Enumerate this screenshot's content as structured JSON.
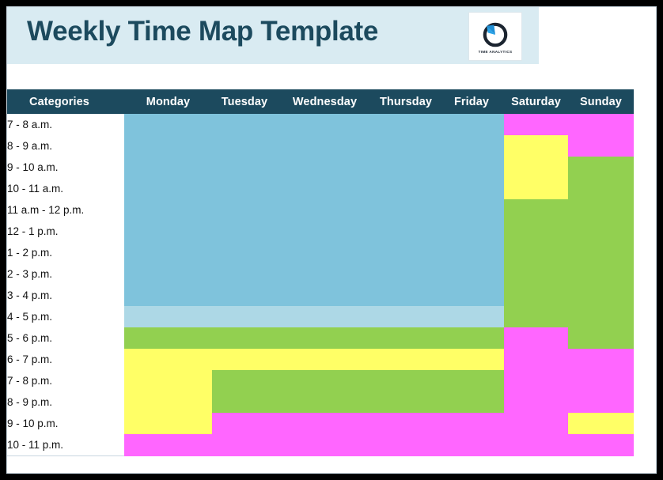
{
  "document": {
    "title": "Weekly Time Map Template"
  },
  "logo": {
    "icon": "clock-circle-arrow-icon",
    "label": "TIME ANALYTICS"
  },
  "colors": {
    "header_bar": "#1c4a5e",
    "banner_bg": "#d9ebf2",
    "title_text": "#1c4a5e",
    "blue": "#7fc3dc",
    "light_blue": "#add8e6",
    "green": "#92d050",
    "yellow": "#ffff66",
    "magenta": "#ff66ff",
    "page_border": "#000000"
  },
  "table": {
    "columns": [
      {
        "key": "categories",
        "label": "Categories"
      },
      {
        "key": "monday",
        "label": "Monday"
      },
      {
        "key": "tuesday",
        "label": "Tuesday"
      },
      {
        "key": "wednesday",
        "label": "Wednesday"
      },
      {
        "key": "thursday",
        "label": "Thursday"
      },
      {
        "key": "friday",
        "label": "Friday"
      },
      {
        "key": "saturday",
        "label": "Saturday"
      },
      {
        "key": "sunday",
        "label": "Sunday"
      }
    ],
    "rows": [
      {
        "label": "7 - 8 a.m.",
        "cells": [
          "blue",
          "blue",
          "blue",
          "blue",
          "blue",
          "magenta",
          "magenta"
        ]
      },
      {
        "label": "8 - 9 a.m.",
        "cells": [
          "blue",
          "blue",
          "blue",
          "blue",
          "blue",
          "yellow",
          "magenta"
        ]
      },
      {
        "label": "9 - 10 a.m.",
        "cells": [
          "blue",
          "blue",
          "blue",
          "blue",
          "blue",
          "yellow",
          "green"
        ]
      },
      {
        "label": "10 - 11 a.m.",
        "cells": [
          "blue",
          "blue",
          "blue",
          "blue",
          "blue",
          "yellow",
          "green"
        ]
      },
      {
        "label": "11 a.m - 12 p.m.",
        "cells": [
          "blue",
          "blue",
          "blue",
          "blue",
          "blue",
          "green",
          "green"
        ]
      },
      {
        "label": "12 - 1 p.m.",
        "cells": [
          "blue",
          "blue",
          "blue",
          "blue",
          "blue",
          "green",
          "green"
        ]
      },
      {
        "label": "1 - 2 p.m.",
        "cells": [
          "blue",
          "blue",
          "blue",
          "blue",
          "blue",
          "green",
          "green"
        ]
      },
      {
        "label": "2 - 3 p.m.",
        "cells": [
          "blue",
          "blue",
          "blue",
          "blue",
          "blue",
          "green",
          "green"
        ]
      },
      {
        "label": "3 - 4 p.m.",
        "cells": [
          "blue",
          "blue",
          "blue",
          "blue",
          "blue",
          "green",
          "green"
        ]
      },
      {
        "label": "4 - 5 p.m.",
        "cells": [
          "light_blue",
          "light_blue",
          "light_blue",
          "light_blue",
          "light_blue",
          "green",
          "green"
        ]
      },
      {
        "label": "5 - 6 p.m.",
        "cells": [
          "green",
          "green",
          "green",
          "green",
          "green",
          "magenta",
          "green"
        ]
      },
      {
        "label": "6 - 7 p.m.",
        "cells": [
          "yellow",
          "yellow",
          "yellow",
          "yellow",
          "yellow",
          "magenta",
          "magenta"
        ]
      },
      {
        "label": "7 - 8 p.m.",
        "cells": [
          "yellow",
          "green",
          "green",
          "green",
          "green",
          "magenta",
          "magenta"
        ]
      },
      {
        "label": "8 - 9 p.m.",
        "cells": [
          "yellow",
          "green",
          "green",
          "green",
          "green",
          "magenta",
          "magenta"
        ]
      },
      {
        "label": "9 - 10 p.m.",
        "cells": [
          "yellow",
          "magenta",
          "magenta",
          "magenta",
          "magenta",
          "magenta",
          "yellow"
        ]
      },
      {
        "label": "10 - 11 p.m.",
        "cells": [
          "magenta",
          "magenta",
          "magenta",
          "magenta",
          "magenta",
          "magenta",
          "magenta"
        ]
      }
    ]
  }
}
